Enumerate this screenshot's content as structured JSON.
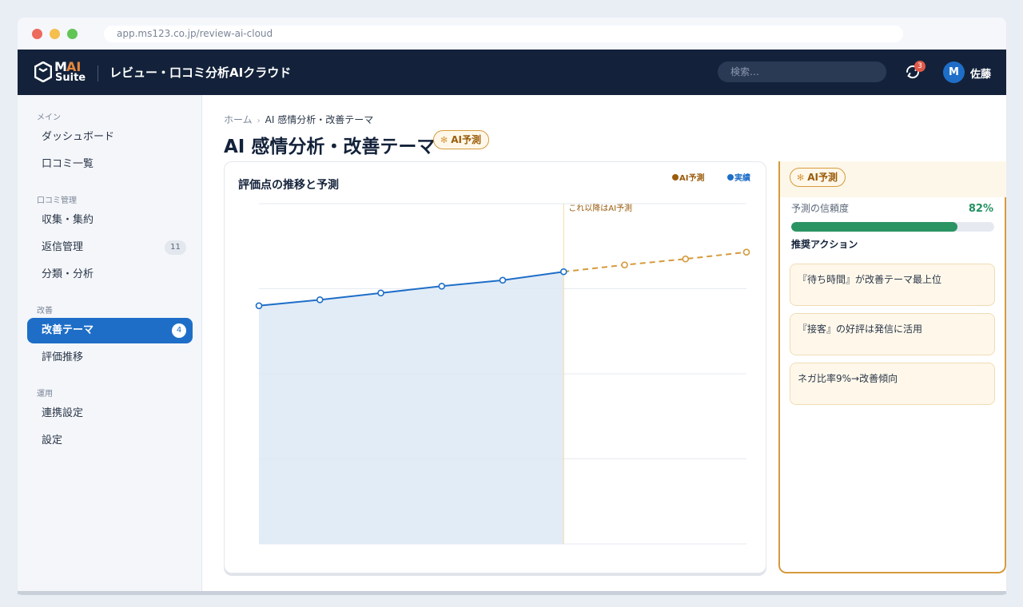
{
  "browser": {
    "url": "app.ms123.co.jp/review-ai-cloud"
  },
  "header": {
    "logo_m": "M",
    "logo_ai": "AI",
    "logo_suite": "Suite",
    "app_title": "レビュー・口コミ分析AIクラウド",
    "search_placeholder": "検索…",
    "notification_count": "3",
    "avatar_initial": "M",
    "user_name": "佐藤"
  },
  "sidebar": {
    "sections": [
      {
        "label": "メイン",
        "items": [
          {
            "label": "ダッシュボード"
          },
          {
            "label": "口コミ一覧"
          }
        ]
      },
      {
        "label": "口コミ管理",
        "items": [
          {
            "label": "収集・集約"
          },
          {
            "label": "返信管理",
            "badge": "11"
          },
          {
            "label": "分類・分析"
          }
        ]
      },
      {
        "label": "改善",
        "items": [
          {
            "label": "改善テーマ",
            "badge": "4",
            "active": true
          },
          {
            "label": "評価推移"
          }
        ]
      },
      {
        "label": "運用",
        "items": [
          {
            "label": "連携設定"
          },
          {
            "label": "設定"
          }
        ]
      }
    ]
  },
  "breadcrumb": {
    "home": "ホーム",
    "separator": "›",
    "current": "AI 感情分析・改善テーマ"
  },
  "page": {
    "title": "AI 感情分析・改善テーマ",
    "ai_badge": "AI予測"
  },
  "chart_card": {
    "title": "評価点の推移と予測",
    "legend_pred": "AI予測",
    "legend_actual": "実績",
    "forecast_note": "これ以降はAI予測"
  },
  "chart_data": {
    "type": "line",
    "title": "評価点の推移と予測",
    "x": [
      1,
      2,
      3,
      4,
      5,
      6,
      7,
      8,
      9
    ],
    "ylim": [
      0,
      4
    ],
    "grid": true,
    "legend_position": "top-right",
    "series": [
      {
        "name": "実績",
        "x": [
          1,
          2,
          3,
          4,
          5,
          6
        ],
        "values": [
          2.8,
          2.87,
          2.95,
          3.03,
          3.1,
          3.2
        ],
        "color": "#1e6ec8",
        "style": "solid",
        "fill": true
      },
      {
        "name": "AI予測",
        "x": [
          6,
          7,
          8,
          9
        ],
        "values": [
          3.2,
          3.28,
          3.35,
          3.43
        ],
        "color": "#d69a3c",
        "style": "dashed"
      }
    ],
    "forecast_start_x": 6
  },
  "ai_panel": {
    "badge": "AI予測",
    "confidence_label": "予測の信頼度",
    "confidence_value": "82%",
    "confidence_fraction": 0.82,
    "actions_title": "推奨アクション",
    "actions": [
      "『待ち時間』が改善テーマ最上位",
      "『接客』の好評は発信に活用",
      "ネガ比率9%→改善傾向"
    ]
  },
  "colors": {
    "header_bg": "#13223a",
    "accent_blue": "#1e6ec8",
    "accent_gold": "#d69a3c",
    "success_green": "#2a9463"
  }
}
